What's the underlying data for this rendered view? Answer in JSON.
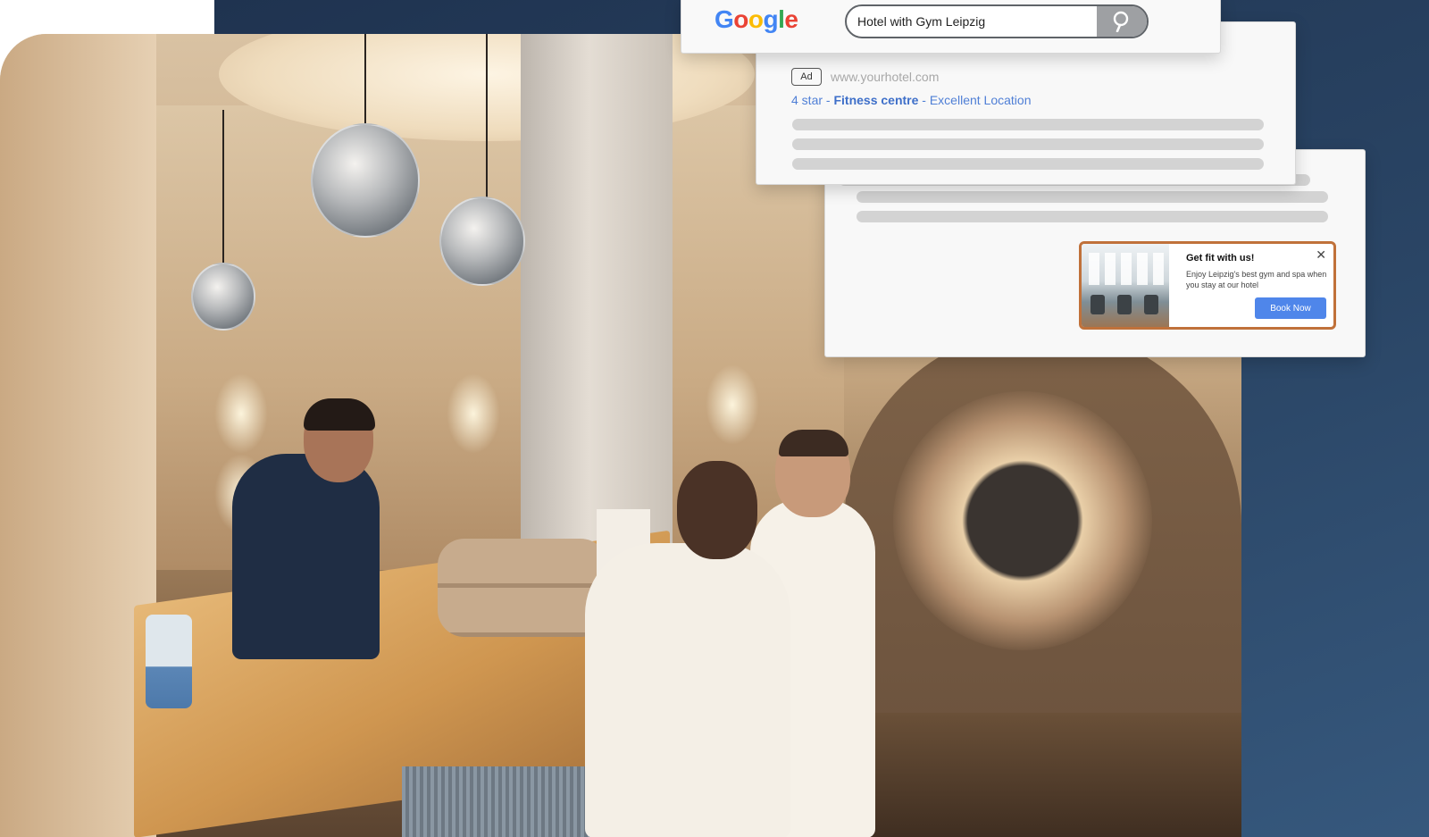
{
  "search": {
    "logo_letters": [
      "G",
      "o",
      "o",
      "g",
      "l",
      "e"
    ],
    "query": "Hotel with Gym Leipzig",
    "button_icon": "magnifier-icon"
  },
  "ad": {
    "badge": "Ad",
    "url": "www.yourhotel.com",
    "headline_prefix": "4 star - ",
    "headline_bold": "Fitness centre",
    "headline_suffix": " - Excellent Location"
  },
  "popup": {
    "title": "Get fit with us!",
    "body": "Enjoy Leipzig's best gym and spa when you stay at our hotel",
    "cta": "Book Now",
    "close_icon": "close-icon",
    "border_color": "#c0713a",
    "cta_color": "#4f86ea"
  },
  "colors": {
    "background_navy": "#1f3350",
    "link_blue": "#4f7fd6"
  }
}
